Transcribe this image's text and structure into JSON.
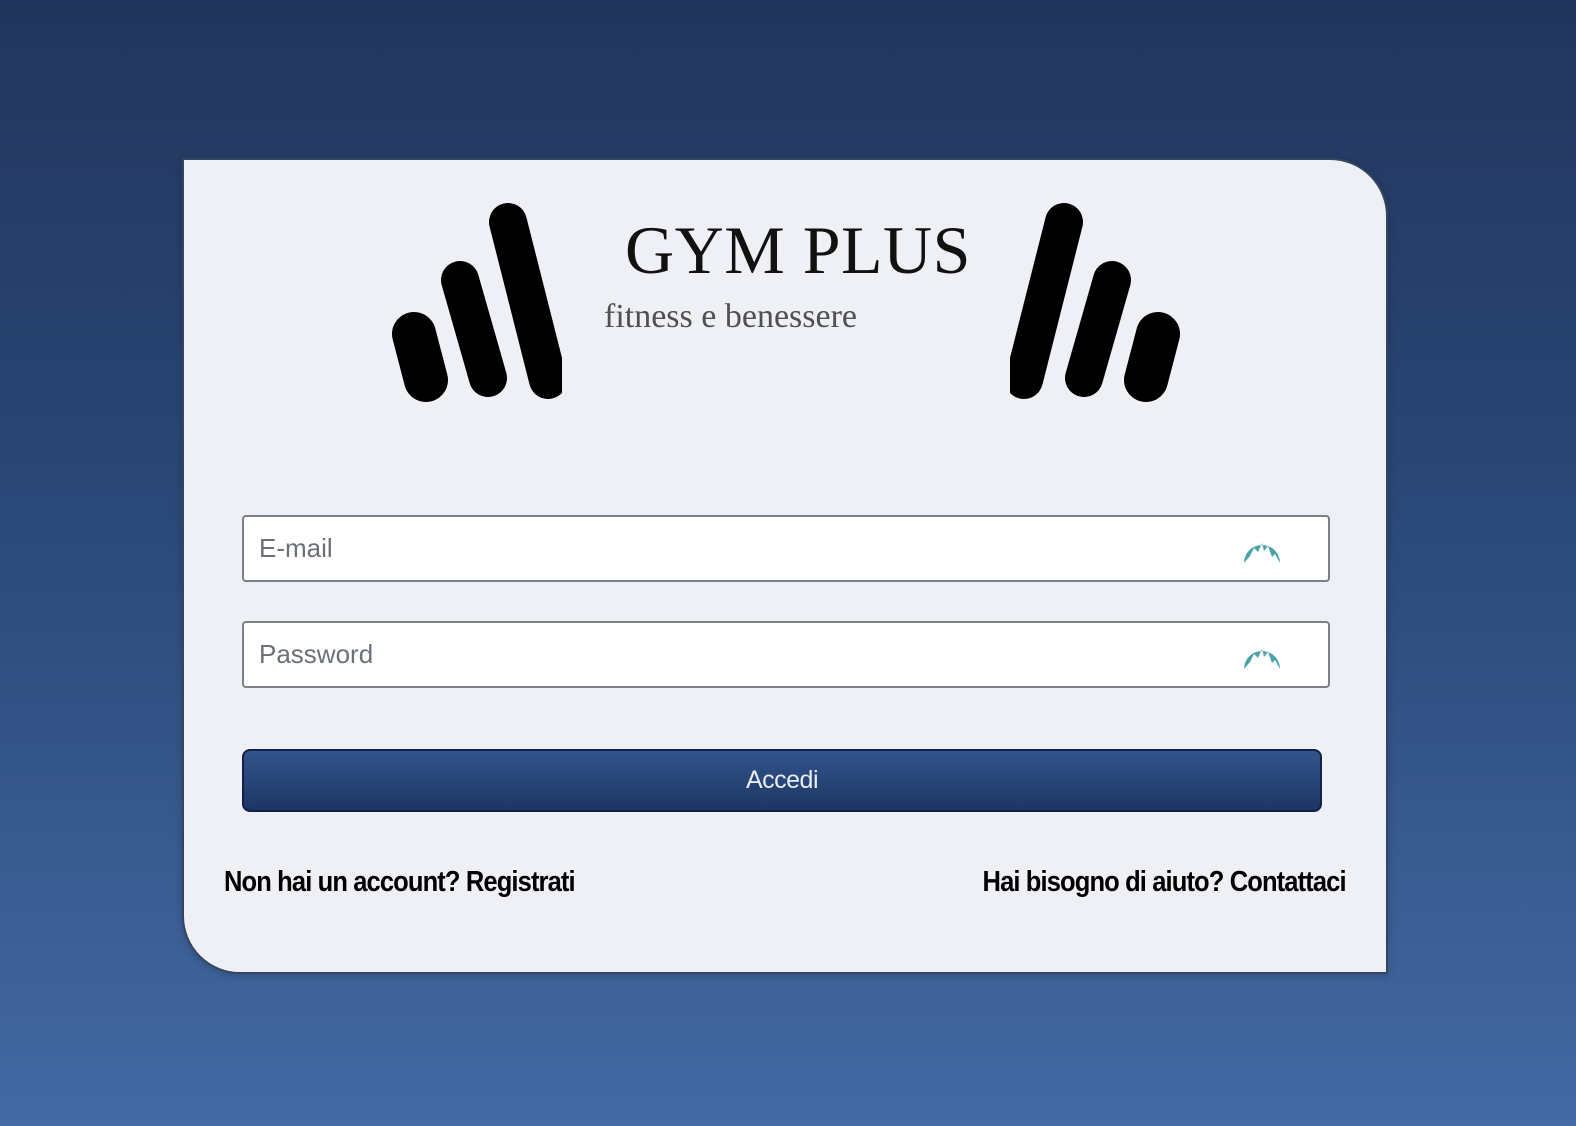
{
  "brand": {
    "title": "GYM PLUS",
    "subtitle": "fitness e benessere",
    "logo_icon": "bars-logo-icon"
  },
  "form": {
    "email": {
      "placeholder": "E-mail",
      "value": "",
      "icon": "nordpass-autofill-icon"
    },
    "password": {
      "placeholder": "Password",
      "value": "",
      "icon": "nordpass-autofill-icon"
    },
    "submit_label": "Accedi"
  },
  "footer": {
    "register_link": "Non hai un account? Registrati",
    "contact_link": "Hai bisogno di aiuto? Contattaci"
  },
  "colors": {
    "background_top": "#22355c",
    "background_bottom": "#4469a3",
    "card": "#eff0f5",
    "button": "#264476",
    "autofill_icon": "#4aa3a8"
  }
}
